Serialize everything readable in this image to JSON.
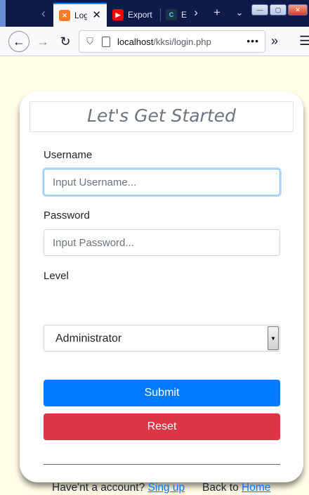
{
  "browser": {
    "tabs": [
      {
        "label": "Login",
        "favicon": "xampp-icon",
        "active": true
      },
      {
        "label": "Export",
        "favicon": "youtube-icon",
        "active": false
      },
      {
        "label": "E",
        "favicon": "codeigniter-icon",
        "active": false
      }
    ],
    "url": {
      "host": "localhost",
      "path": "/kksi/login.php"
    },
    "accent": "#0a84ff"
  },
  "form": {
    "title": "Let's Get Started",
    "username": {
      "label": "Username",
      "placeholder": "Input Username..."
    },
    "password": {
      "label": "Password",
      "placeholder": "Input Password..."
    },
    "level": {
      "label": "Level",
      "selected": "Administrator"
    },
    "submit_label": "Submit",
    "reset_label": "Reset"
  },
  "footer": {
    "account_text": "Have'nt a account?",
    "signup_link": "Sing up",
    "back_text": "Back to",
    "home_link": "Home"
  },
  "colors": {
    "primary": "#007bff",
    "danger": "#dc3545",
    "page_bg": "#fffde6"
  }
}
